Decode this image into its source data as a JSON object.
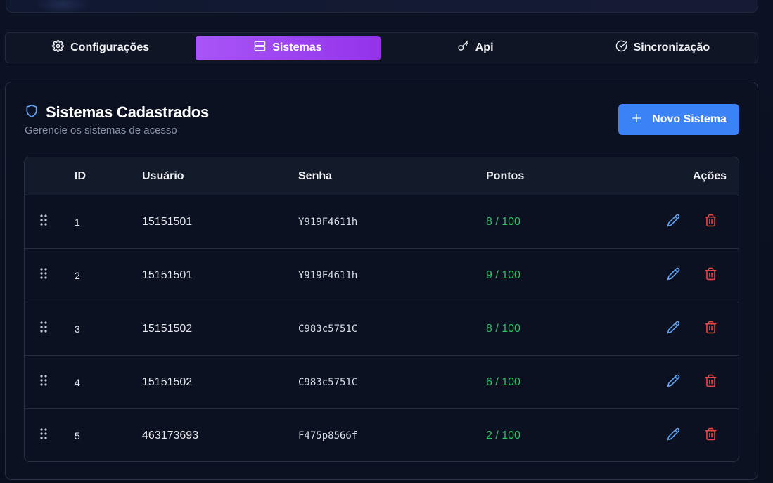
{
  "tabs": [
    {
      "label": "Configurações",
      "icon": "gear-icon",
      "active": false
    },
    {
      "label": "Sistemas",
      "icon": "server-icon",
      "active": true
    },
    {
      "label": "Api",
      "icon": "key-icon",
      "active": false
    },
    {
      "label": "Sincronização",
      "icon": "check-circle-icon",
      "active": false
    }
  ],
  "card": {
    "title": "Sistemas Cadastrados",
    "subtitle": "Gerencie os sistemas de acesso",
    "new_button_label": "Novo Sistema"
  },
  "table": {
    "headers": {
      "id": "ID",
      "user": "Usuário",
      "password": "Senha",
      "points": "Pontos",
      "actions": "Ações"
    },
    "rows": [
      {
        "id": "1",
        "user": "15151501",
        "password": "Y919F4611h",
        "points": "8 / 100"
      },
      {
        "id": "2",
        "user": "15151501",
        "password": "Y919F4611h",
        "points": "9 / 100"
      },
      {
        "id": "3",
        "user": "15151502",
        "password": "C983c5751C",
        "points": "8 / 100"
      },
      {
        "id": "4",
        "user": "15151502",
        "password": "C983c5751C",
        "points": "6 / 100"
      },
      {
        "id": "5",
        "user": "463173693",
        "password": "F475p8566f",
        "points": "2 / 100"
      }
    ]
  },
  "colors": {
    "accent_purple": "#9333ea",
    "primary_blue": "#3b82f6",
    "points_green": "#22c55e",
    "delete_red": "#ef4444",
    "edit_blue": "#60a5fa"
  }
}
